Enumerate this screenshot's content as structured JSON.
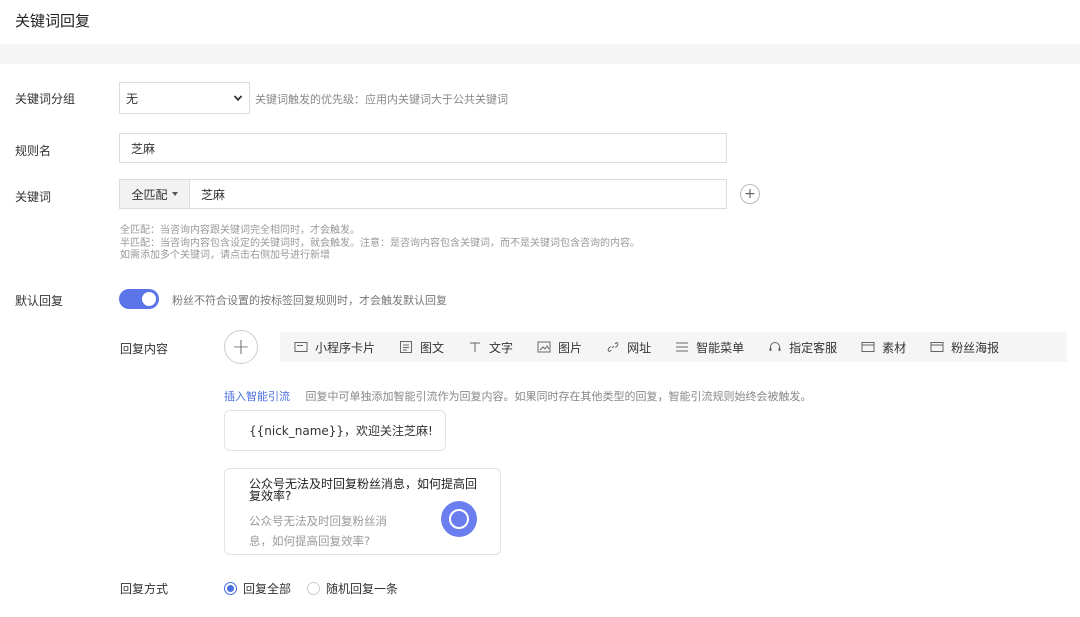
{
  "page": {
    "title": "关键词回复"
  },
  "group": {
    "label": "关键词分组",
    "value": "无",
    "hint": "关键词触发的优先级：应用内关键词大于公共关键词"
  },
  "rule": {
    "label": "规则名",
    "value": "芝麻"
  },
  "keyword": {
    "label": "关键词",
    "match_mode": "全匹配",
    "value": "芝麻",
    "help": [
      "全匹配：当咨询内容跟关键词完全相同时，才会触发。",
      "半匹配：当咨询内容包含设定的关键词时，就会触发。注意：是咨询内容包含关键词，而不是关键词包含咨询的内容。",
      "如需添加多个关键词，请点击右侧加号进行新增"
    ]
  },
  "default_reply": {
    "label": "默认回复",
    "enabled": true,
    "hint": "粉丝不符合设置的按标签回复规则时，才会触发默认回复"
  },
  "reply_content": {
    "label": "回复内容",
    "tools": [
      {
        "icon": "mini-program-card-icon",
        "label": "小程序卡片"
      },
      {
        "icon": "article-icon",
        "label": "图文"
      },
      {
        "icon": "text-icon",
        "label": "文字"
      },
      {
        "icon": "image-icon",
        "label": "图片"
      },
      {
        "icon": "link-icon",
        "label": "网址"
      },
      {
        "icon": "menu-icon",
        "label": "智能菜单"
      },
      {
        "icon": "headset-icon",
        "label": "指定客服"
      },
      {
        "icon": "material-icon",
        "label": "素材"
      },
      {
        "icon": "poster-icon",
        "label": "粉丝海报"
      }
    ],
    "smart_link": "插入智能引流",
    "smart_hint": "回复中可单独添加智能引流作为回复内容。如果同时存在其他类型的回复，智能引流规则始终会被触发。",
    "message": "{{nick_name}}，欢迎关注芝麻!",
    "promo": {
      "title": "公众号无法及时回复粉丝消息，如何提高回复效率?",
      "desc": "公众号无法及时回复粉丝消息，如何提高回复效率?"
    }
  },
  "reply_mode": {
    "label": "回复方式",
    "options": [
      "回复全部",
      "随机回复一条"
    ],
    "selected": "回复全部"
  },
  "colors": {
    "accent": "#4a6ee0",
    "switch": "#5b74e8",
    "toolbar_bg": "#f5f5f5"
  }
}
